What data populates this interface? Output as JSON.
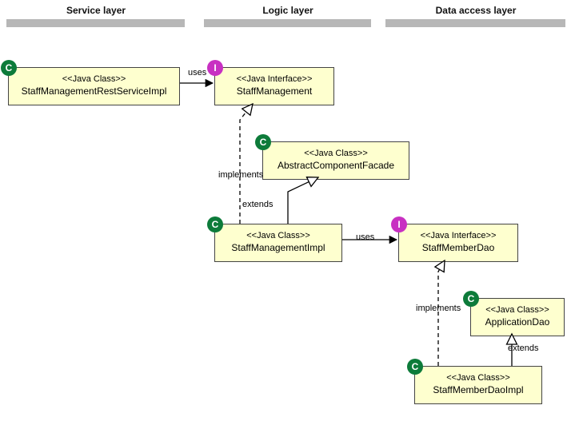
{
  "columns": {
    "service": {
      "title": "Service layer"
    },
    "logic": {
      "title": "Logic layer"
    },
    "data": {
      "title": "Data access layer"
    }
  },
  "nodes": {
    "serviceImpl": {
      "badge": "C",
      "stereotype": "<<Java Class>>",
      "name": "StaffManagementRestServiceImpl"
    },
    "staffMgmt": {
      "badge": "I",
      "stereotype": "<<Java Interface>>",
      "name": "StaffManagement"
    },
    "facade": {
      "badge": "C",
      "stereotype": "<<Java Class>>",
      "name": "AbstractComponentFacade"
    },
    "mgmtImpl": {
      "badge": "C",
      "stereotype": "<<Java Class>>",
      "name": "StaffManagementImpl"
    },
    "memberDao": {
      "badge": "I",
      "stereotype": "<<Java Interface>>",
      "name": "StaffMemberDao"
    },
    "appDao": {
      "badge": "C",
      "stereotype": "<<Java Class>>",
      "name": "ApplicationDao"
    },
    "memberDaoImpl": {
      "badge": "C",
      "stereotype": "<<Java Class>>",
      "name": "StaffMemberDaoImpl"
    }
  },
  "labels": {
    "uses": "uses",
    "implements": "implements",
    "extends": "extends"
  }
}
